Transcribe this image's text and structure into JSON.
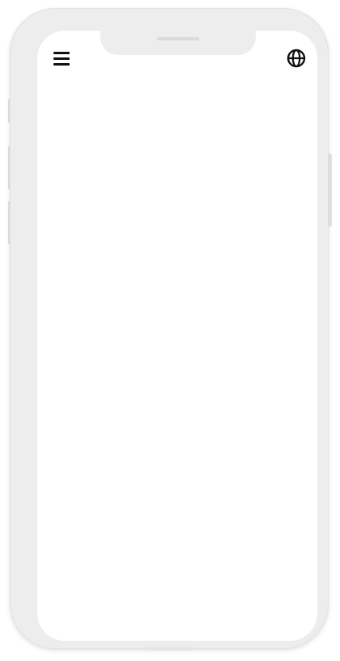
{
  "device": {
    "frame_color": "#ededed",
    "screen_color": "#ffffff"
  },
  "top_bar": {
    "left_icon": "menu-icon",
    "right_icon": "globe-icon",
    "icon_color": "#111111"
  }
}
